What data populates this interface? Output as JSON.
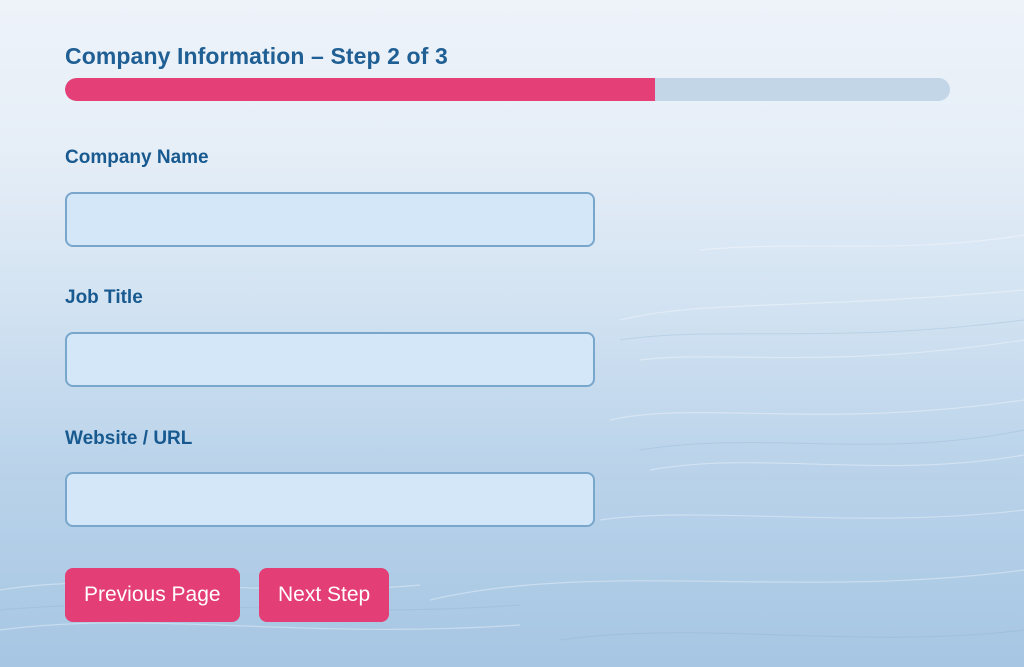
{
  "form": {
    "step_title": "Company Information – Step 2 of 3",
    "progress": {
      "current_step": 2,
      "total_steps": 3,
      "fraction": 0.667
    },
    "fields": [
      {
        "label": "Company Name",
        "value": ""
      },
      {
        "label": "Job Title",
        "value": ""
      },
      {
        "label": "Website / URL",
        "value": ""
      }
    ],
    "buttons": {
      "previous_label": "Previous Page",
      "next_label": "Next Step"
    }
  },
  "colors": {
    "accent": "#e43f76",
    "label_text": "#185a90",
    "progress_track": "#c2d6e8",
    "input_fill": "#d4e7f8",
    "input_border": "#79a6cb"
  }
}
